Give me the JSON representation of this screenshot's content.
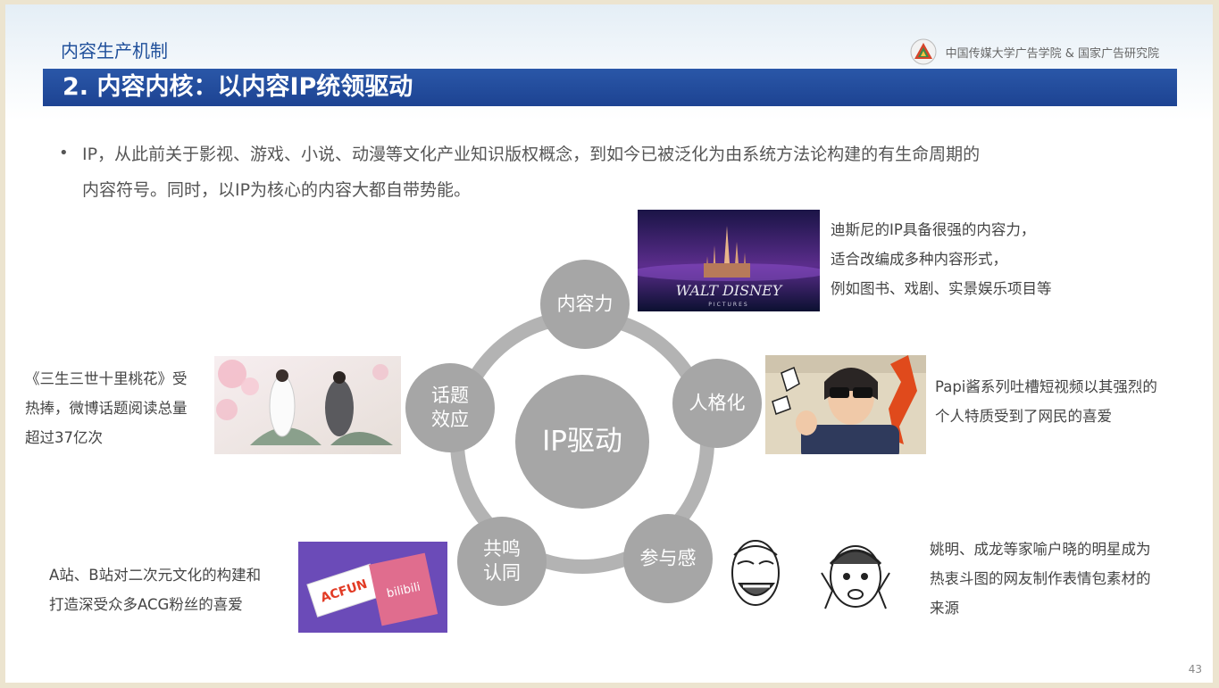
{
  "header": {
    "section_label": "内容生产机制",
    "org": "中国传媒大学广告学院 & 国家广告研究院"
  },
  "title": "2. 内容内核：以内容IP统领驱动",
  "bullet": {
    "line1": "IP，从此前关于影视、游戏、小说、动漫等文化产业知识版权概念，到如今已被泛化为由系统方法论构建的有生命周期的",
    "line2": "内容符号。同时，以IP为核心的内容大都自带势能。"
  },
  "diagram": {
    "center": "IP驱动",
    "nodes": {
      "content_power": "内容力",
      "personality": "人格化",
      "participation": "参与感",
      "resonance_1": "共鸣",
      "resonance_2": "认同",
      "topic_1": "话题",
      "topic_2": "效应"
    }
  },
  "images": {
    "disney_text": "WALT DISNEY",
    "disney_sub": "PICTURES",
    "acfun": "ACFUN",
    "bilibili": "bilibili"
  },
  "captions": {
    "disney": [
      "迪斯尼的IP具备很强的内容力，",
      "适合改编成多种内容形式，",
      "例如图书、戏剧、实景娱乐项目等"
    ],
    "papi": [
      "Papi酱系列吐槽短视频以其强烈的",
      "个人特质受到了网民的喜爱"
    ],
    "stars": [
      "姚明、成龙等家喻户晓的明星成为",
      "热衷斗图的网友制作表情包素材的",
      "来源"
    ],
    "acg": [
      "A站、B站对二次元文化的构建和",
      "打造深受众多ACG粉丝的喜爱"
    ],
    "peach": [
      "《三生三世十里桃花》受",
      "热捧，微博话题阅读总量",
      "超过37亿次"
    ]
  },
  "page_number": "43",
  "colors": {
    "title_bar": "#1d4392",
    "section_label": "#1f4f9a",
    "node_gray": "#a6a6a6",
    "ring_gray": "#b3b3b3"
  }
}
